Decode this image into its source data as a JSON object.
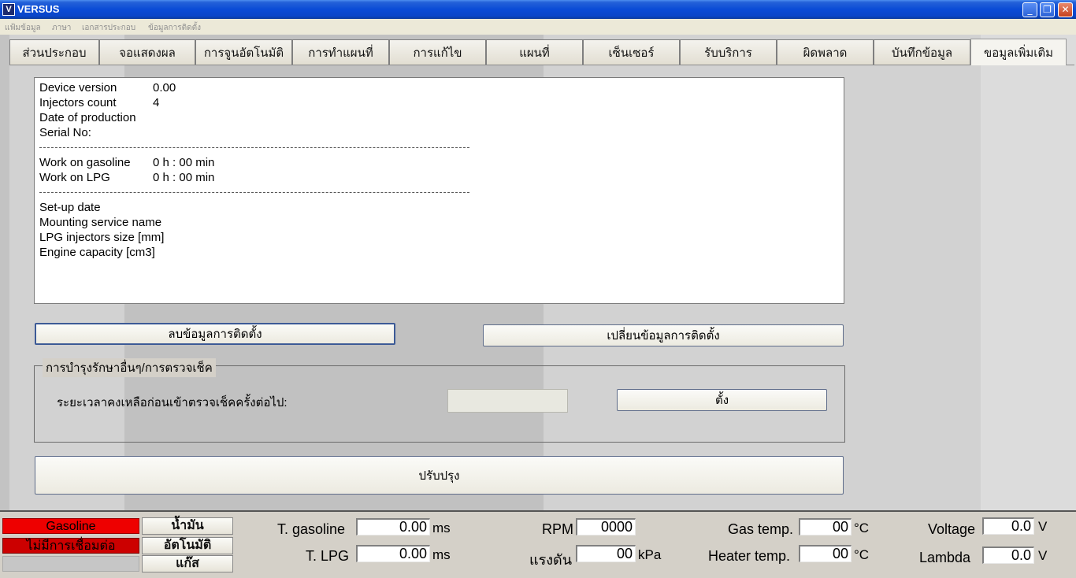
{
  "window": {
    "title": "VERSUS",
    "icon": "versus-logo-icon",
    "minimize": "_",
    "restore": "❐",
    "close": "✕"
  },
  "menu": [
    "แฟ้มข้อมูล",
    "ภาษา",
    "เอกสารประกอบ",
    "ข้อมูลการติดตั้ง"
  ],
  "tabs": [
    "ส่วนประกอบ",
    "จอแสดงผล",
    "การจูนอัตโนมัติ",
    "การทำแผนที่",
    "การแก้ไข",
    "แผนที่",
    "เซ็นเซอร์",
    "รับบริการ",
    "ผิดพลาด",
    "บันทึกข้อมูล",
    "ขอมูลเพิ่มเติม"
  ],
  "active_tab": "ขอมูลเพิ่มเติม",
  "info": {
    "device_version_label": "Device version",
    "device_version": "0.00",
    "injectors_count_label": "Injectors count",
    "injectors_count": "4",
    "date_of_production_label": "Date of production",
    "serial_no_label": "Serial No:",
    "work_gasoline_label": "Work on gasoline",
    "work_gasoline": "0 h : 00 min",
    "work_lpg_label": "Work on LPG",
    "work_lpg": "0 h : 00 min",
    "setup_date_label": "Set-up date",
    "mounting_service_label": "Mounting service name",
    "lpg_injectors_size_label": "LPG injectors size [mm]",
    "engine_capacity_label": "Engine capacity [cm3]"
  },
  "buttons": {
    "delete_install": "ลบข้อมูลการติดตั้ง",
    "change_install": "เปลี่ยนข้อมูลการติดตั้ง",
    "set": "ตั้ง",
    "update": "ปรับปรุง"
  },
  "maintenance": {
    "title": "การบำรุงรักษาอื่นๆ/การตรวจเช็ค",
    "remaining_label": "ระยะเวลาคงเหลือก่อนเข้าตรวจเช็คครั้งต่อไป:",
    "remaining_value": ""
  },
  "status": {
    "fuel_indicator": "Gasoline",
    "connection_indicator": "ไม่มีการเชื่อมต่อ",
    "indicator_color": "#ee0000",
    "mode_buttons": [
      "น้ำมัน",
      "อัตโนมัติ",
      "แก๊ส"
    ],
    "t_gasoline_label": "T. gasoline",
    "t_gasoline": "0.00",
    "t_gasoline_unit": "ms",
    "t_lpg_label": "T. LPG",
    "t_lpg": "0.00",
    "t_lpg_unit": "ms",
    "rpm_label": "RPM",
    "rpm": "0000",
    "pressure_label": "แรงดัน",
    "pressure": "00",
    "pressure_unit": "kPa",
    "gas_temp_label": "Gas temp.",
    "gas_temp": "00",
    "gas_temp_unit": "°C",
    "heater_temp_label": "Heater temp.",
    "heater_temp": "00",
    "heater_temp_unit": "°C",
    "voltage_label": "Voltage",
    "voltage": "0.0",
    "voltage_unit": "V",
    "lambda_label": "Lambda",
    "lambda": "0.0",
    "lambda_unit": "V"
  }
}
